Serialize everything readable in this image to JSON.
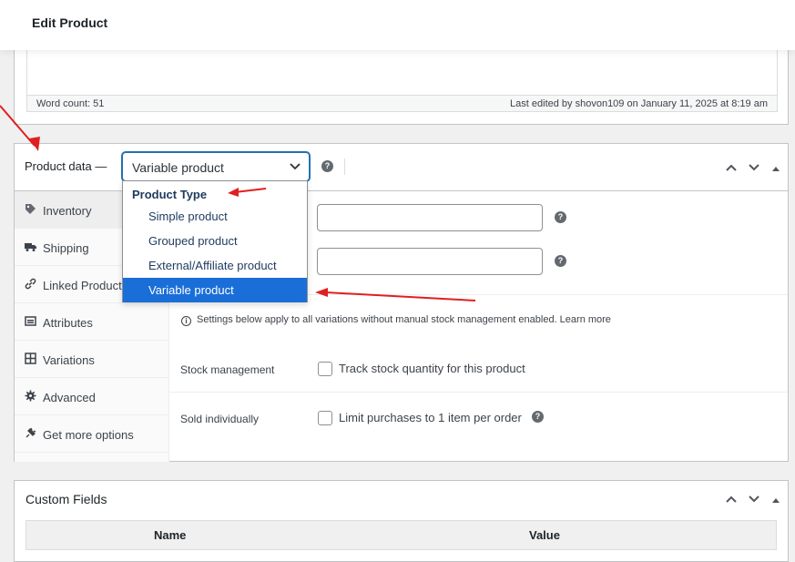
{
  "page": {
    "title": "Edit Product"
  },
  "editor": {
    "word_count": "Word count: 51",
    "last_edited": "Last edited by shovon109 on January 11, 2025 at 8:19 am"
  },
  "product_data": {
    "label": "Product data —",
    "selected_type": "Variable product",
    "help": "?",
    "dropdown": {
      "group_label": "Product Type",
      "options": [
        "Simple product",
        "Grouped product",
        "External/Affiliate product",
        "Variable product"
      ],
      "selected_index": 3
    },
    "tabs": [
      "Inventory",
      "Shipping",
      "Linked Products",
      "Attributes",
      "Variations",
      "Advanced",
      "Get more options"
    ],
    "notice": "Settings below apply to all variations without manual stock management enabled. Learn more",
    "stock_management": {
      "label": "Stock management",
      "checkbox_label": "Track stock quantity for this product"
    },
    "sold_individually": {
      "label": "Sold individually",
      "checkbox_label": "Limit purchases to 1 item per order"
    }
  },
  "custom_fields": {
    "title": "Custom Fields",
    "col_name": "Name",
    "col_value": "Value"
  },
  "colors": {
    "accent": "#2271b1",
    "selected_option": "#1a6ed8",
    "annotation_arrow": "#e02020"
  }
}
